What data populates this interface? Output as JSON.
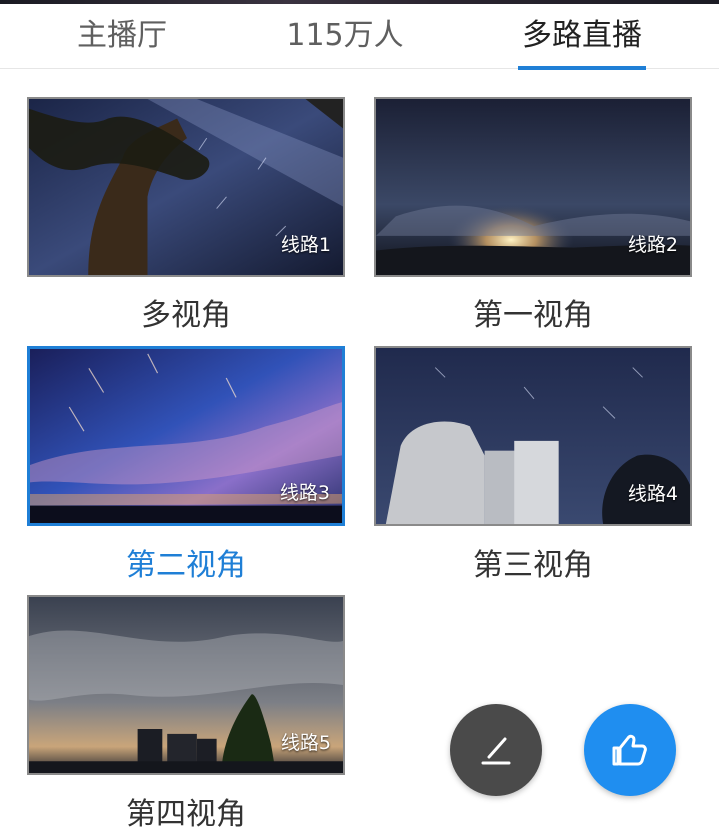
{
  "tabs": [
    {
      "label": "主播厅",
      "active": false
    },
    {
      "label": "115万人",
      "active": false
    },
    {
      "label": "多路直播",
      "active": true
    }
  ],
  "streams": [
    {
      "line": "线路1",
      "caption": "多视角",
      "selected": false
    },
    {
      "line": "线路2",
      "caption": "第一视角",
      "selected": false
    },
    {
      "line": "线路3",
      "caption": "第二视角",
      "selected": true
    },
    {
      "line": "线路4",
      "caption": "第三视角",
      "selected": false
    },
    {
      "line": "线路5",
      "caption": "第四视角",
      "selected": false
    }
  ],
  "actions": {
    "comment_icon": "edit-pencil-icon",
    "like_icon": "thumbs-up-icon"
  },
  "colors": {
    "accent": "#1f7fd6",
    "like_button": "#1f8ef0",
    "edit_button": "#4a4a4a"
  }
}
